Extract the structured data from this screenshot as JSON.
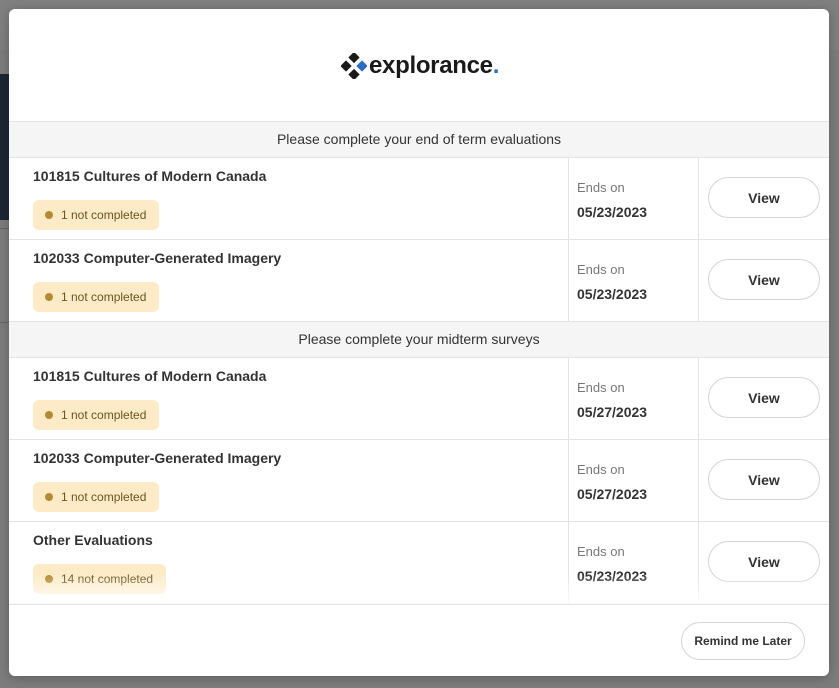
{
  "brand": {
    "name": "explorance",
    "dot": ".",
    "accent": "#2b6cc4"
  },
  "sections": [
    {
      "title": "Please complete your end of term evaluations",
      "rows": [
        {
          "course": "101815 Cultures of Modern Canada",
          "status": "1 not completed",
          "ends_label": "Ends on",
          "ends_date": "05/23/2023",
          "action": "View"
        },
        {
          "course": "102033 Computer-Generated Imagery",
          "status": "1 not completed",
          "ends_label": "Ends on",
          "ends_date": "05/23/2023",
          "action": "View"
        }
      ]
    },
    {
      "title": "Please complete your midterm surveys",
      "rows": [
        {
          "course": "101815 Cultures of Modern Canada",
          "status": "1 not completed",
          "ends_label": "Ends on",
          "ends_date": "05/27/2023",
          "action": "View"
        },
        {
          "course": "102033 Computer-Generated Imagery",
          "status": "1 not completed",
          "ends_label": "Ends on",
          "ends_date": "05/27/2023",
          "action": "View"
        },
        {
          "course": "Other Evaluations",
          "status": "14 not completed",
          "ends_label": "Ends on",
          "ends_date": "05/23/2023",
          "action": "View"
        }
      ]
    }
  ],
  "footer": {
    "remind_label": "Remind me Later"
  },
  "colors": {
    "badge_bg": "#fdebc8",
    "badge_dot": "#b58a32",
    "section_bg": "#f5f5f5"
  }
}
